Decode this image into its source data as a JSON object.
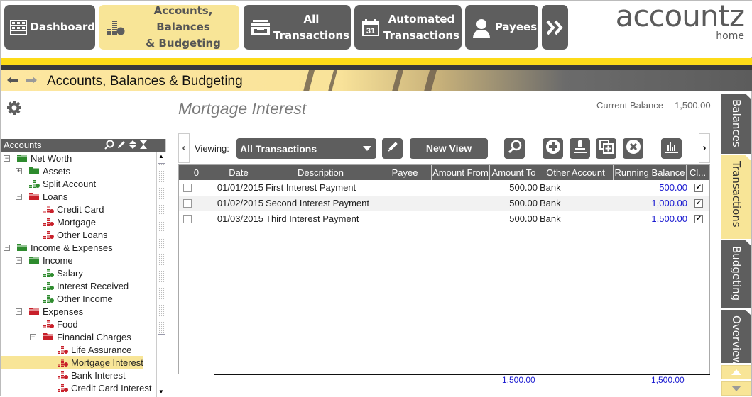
{
  "nav": {
    "buttons": [
      {
        "label": "Dashboard",
        "icon": "grid-icon",
        "active": false
      },
      {
        "label1": "Accounts, Balances",
        "label2": "& Budgeting",
        "icon": "coins-icon",
        "active": true
      },
      {
        "label1": "All",
        "label2": "Transactions",
        "icon": "inbox-tray-icon",
        "active": false
      },
      {
        "label1": "Automated",
        "label2": "Transactions",
        "icon": "calendar-icon",
        "active": false
      },
      {
        "label": "Payees",
        "icon": "person-icon",
        "active": false
      }
    ],
    "more_icon": "double-chevron-right-icon",
    "calendar_day": "31"
  },
  "logo": {
    "name": "accountz",
    "sub": "home"
  },
  "breadcrumb": {
    "title": "Accounts, Balances & Budgeting"
  },
  "account": {
    "title": "Mortgage Interest",
    "balance_label": "Current Balance",
    "balance_value": "1,500.00"
  },
  "sidebar": {
    "header": "Accounts",
    "tree": [
      {
        "label": "Net Worth",
        "level": 0,
        "type": "folder",
        "color": "green",
        "expander": "minus"
      },
      {
        "label": "Assets",
        "level": 1,
        "type": "folder-closed",
        "color": "green",
        "expander": "plus"
      },
      {
        "label": "Split Account",
        "level": 2,
        "type": "account",
        "color": "green"
      },
      {
        "label": "Loans",
        "level": 1,
        "type": "folder",
        "color": "red",
        "expander": "minus"
      },
      {
        "label": "Credit Card",
        "level": 3,
        "type": "account",
        "color": "red"
      },
      {
        "label": "Mortgage",
        "level": 3,
        "type": "account",
        "color": "red"
      },
      {
        "label": "Other Loans",
        "level": 3,
        "type": "account",
        "color": "red"
      },
      {
        "label": "Income & Expenses",
        "level": 0,
        "type": "folder",
        "color": "green",
        "expander": "minus"
      },
      {
        "label": "Income",
        "level": 1,
        "type": "folder",
        "color": "green",
        "expander": "minus"
      },
      {
        "label": "Salary",
        "level": 3,
        "type": "account",
        "color": "green"
      },
      {
        "label": "Interest Received",
        "level": 3,
        "type": "account",
        "color": "green"
      },
      {
        "label": "Other Income",
        "level": 3,
        "type": "account",
        "color": "green"
      },
      {
        "label": "Expenses",
        "level": 1,
        "type": "folder",
        "color": "red",
        "expander": "minus"
      },
      {
        "label": "Food",
        "level": 3,
        "type": "account",
        "color": "red"
      },
      {
        "label": "Financial Charges",
        "level": 2,
        "type": "folder",
        "color": "red",
        "expander": "minus"
      },
      {
        "label": "Life Assurance",
        "level": 4,
        "type": "account",
        "color": "red"
      },
      {
        "label": "Mortgage Interest",
        "level": 4,
        "type": "account",
        "color": "red",
        "selected": true
      },
      {
        "label": "Bank Interest",
        "level": 4,
        "type": "account",
        "color": "red"
      },
      {
        "label": "Credit Card Interest",
        "level": 4,
        "type": "account",
        "color": "red"
      }
    ]
  },
  "toolbar": {
    "viewing_label": "Viewing:",
    "view_selected": "All Transactions",
    "new_view_label": "New View"
  },
  "table": {
    "columns": [
      "0",
      "Date",
      "Description",
      "Payee",
      "Amount From",
      "Amount To",
      "Other Account",
      "Running Balance",
      "Cl..."
    ],
    "rows": [
      {
        "date": "01/01/2015",
        "description": "First Interest Payment",
        "payee": "",
        "amount_from": "",
        "amount_to": "500.00",
        "other_account": "Bank",
        "running_balance": "500.00",
        "cleared": true
      },
      {
        "date": "01/02/2015",
        "description": "Second Interest Payment",
        "payee": "",
        "amount_from": "",
        "amount_to": "500.00",
        "other_account": "Bank",
        "running_balance": "1,000.00",
        "cleared": true
      },
      {
        "date": "01/03/2015",
        "description": "Third Interest Payment",
        "payee": "",
        "amount_from": "",
        "amount_to": "500.00",
        "other_account": "Bank",
        "running_balance": "1,500.00",
        "cleared": true
      }
    ],
    "totals": {
      "amount_to": "1,500.00",
      "running_balance": "1,500.00"
    }
  },
  "right_tabs": [
    {
      "label": "Balances",
      "active": false
    },
    {
      "label": "Transactions",
      "active": true
    },
    {
      "label": "Budgeting",
      "active": false
    },
    {
      "label": "Overview",
      "active": false
    }
  ],
  "colors": {
    "accent_yellow": "#f8e597",
    "button_gray": "#5e5e5e",
    "folder_green": "#2e8b2e",
    "account_red": "#c8202a",
    "balance_blue": "#1a1ad0"
  }
}
